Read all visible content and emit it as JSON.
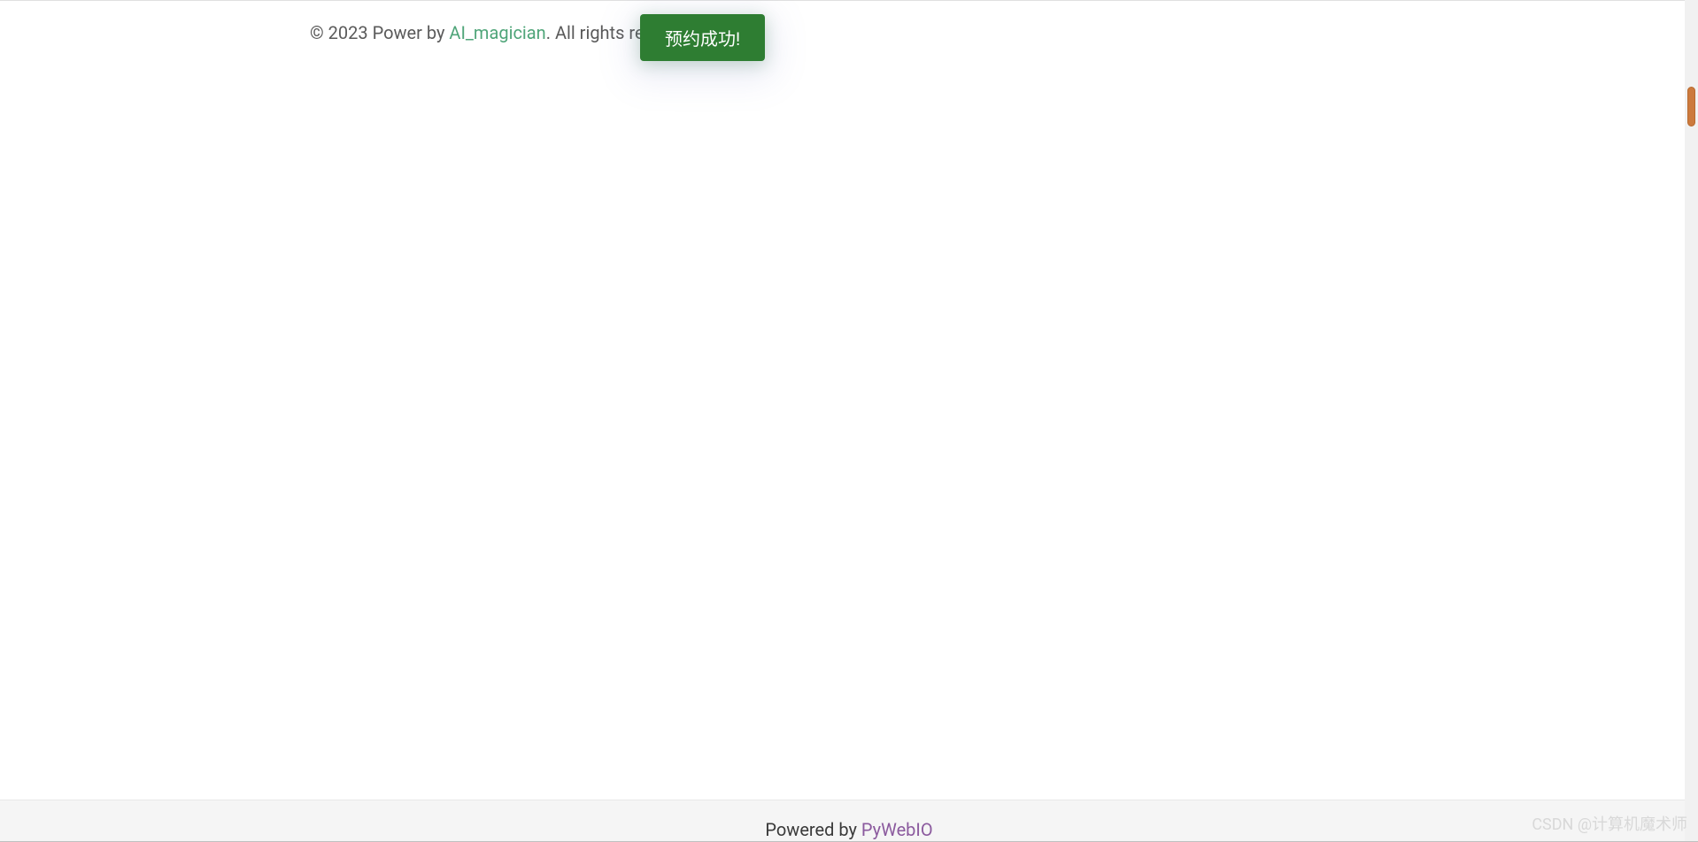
{
  "copyright": {
    "prefix": "© 2023 Power by ",
    "link_text": "AI_magician",
    "suffix": ". All rights reserved."
  },
  "toast": {
    "message": "预约成功!"
  },
  "footer": {
    "prefix": "Powered by ",
    "link_text": "PyWebIO"
  },
  "watermark": {
    "text": "CSDN @计算机魔术师"
  }
}
